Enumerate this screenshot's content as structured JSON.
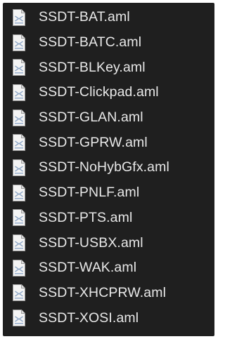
{
  "file_list": {
    "icon": "document-icon",
    "items": [
      {
        "name": "SSDT-BAT.aml"
      },
      {
        "name": "SSDT-BATC.aml"
      },
      {
        "name": "SSDT-BLKey.aml"
      },
      {
        "name": "SSDT-Clickpad.aml"
      },
      {
        "name": "SSDT-GLAN.aml"
      },
      {
        "name": "SSDT-GPRW.aml"
      },
      {
        "name": "SSDT-NoHybGfx.aml"
      },
      {
        "name": "SSDT-PNLF.aml"
      },
      {
        "name": "SSDT-PTS.aml"
      },
      {
        "name": "SSDT-USBX.aml"
      },
      {
        "name": "SSDT-WAK.aml"
      },
      {
        "name": "SSDT-XHCPRW.aml"
      },
      {
        "name": "SSDT-XOSI.aml"
      }
    ]
  }
}
